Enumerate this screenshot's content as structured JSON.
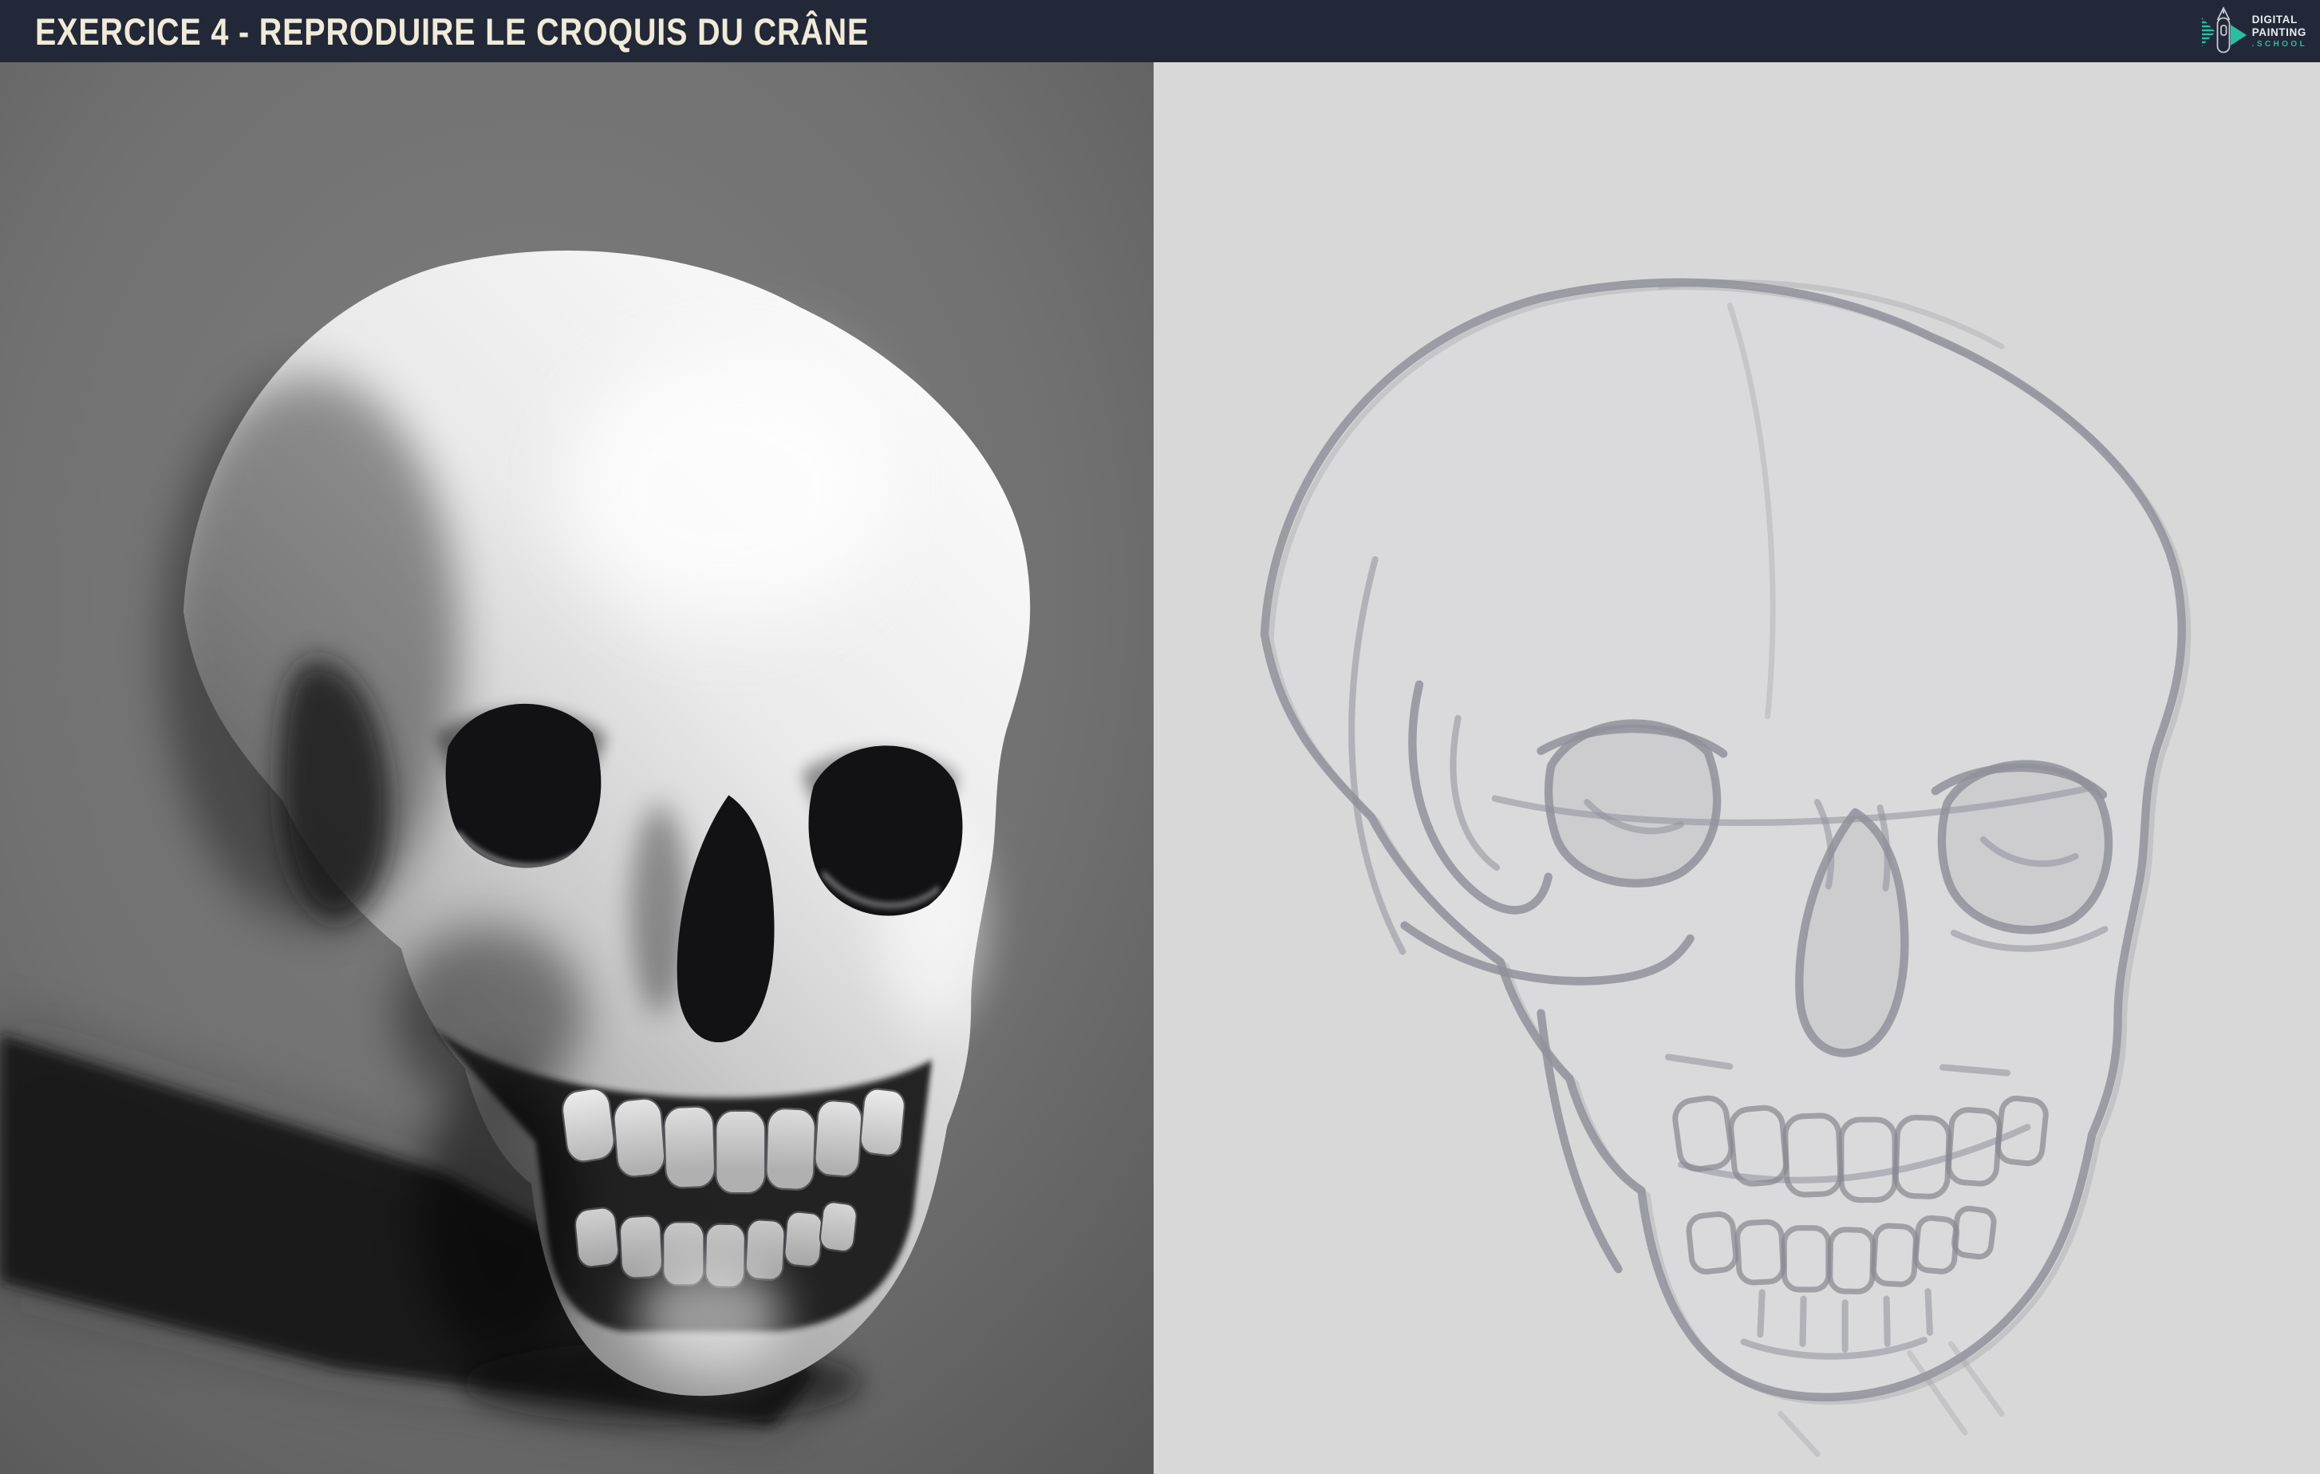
{
  "header": {
    "title": "EXERCICE 4 - REPRODUIRE LE CROQUIS DU CRÂNE"
  },
  "logo": {
    "word1": "DIGITAL",
    "word2": "PAINTING",
    "word3": ".SCHOOL"
  },
  "panels": {
    "left": {
      "label": "3D grayscale render of a human skull in three-quarter view, lit from the upper right, casting a dark shadow to the lower left"
    },
    "right": {
      "label": "Soft gray pencil-style sketch reproducing the same skull on a light gray canvas"
    }
  },
  "colors": {
    "header_bg": "#232838",
    "title_text": "#EFEBD8",
    "logo_accent": "#29BE9E",
    "logo_text": "#E8ECEF",
    "left_panel_bg": "#747474",
    "right_panel_bg": "#D8D8D9",
    "sketch_stroke": "#90909A",
    "bone_light": "#FBFBFB",
    "bone_dark": "#7E7E7E",
    "cast_shadow": "#151515"
  }
}
